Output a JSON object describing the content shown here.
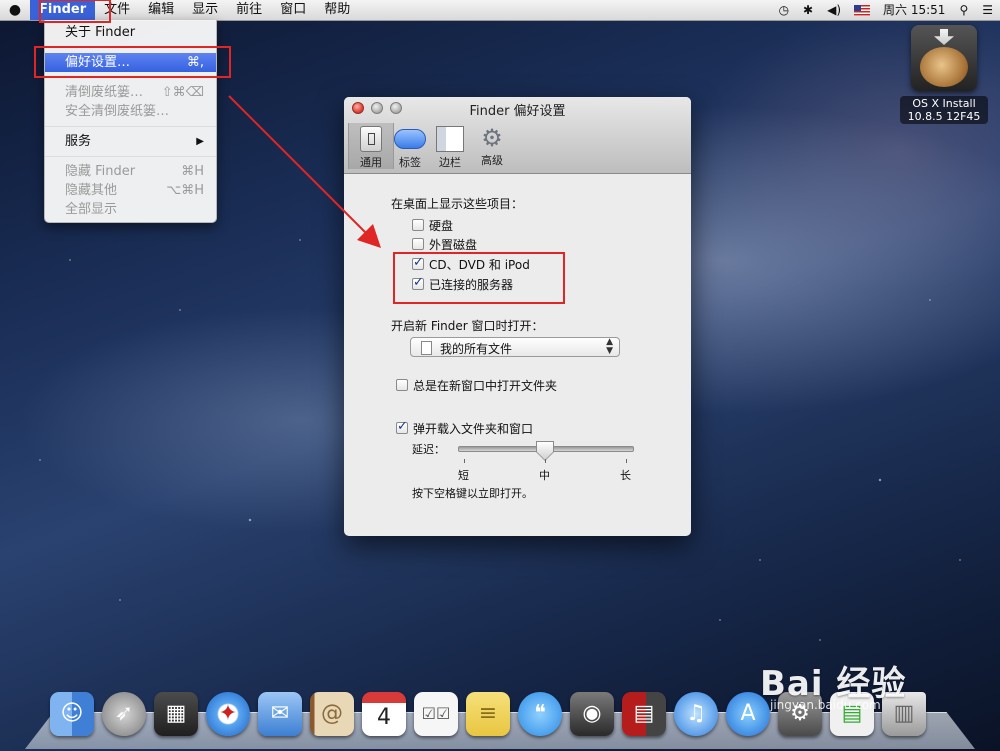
{
  "menubar": {
    "app_name": "Finder",
    "items": [
      "文件",
      "编辑",
      "显示",
      "前往",
      "窗口",
      "帮助"
    ],
    "clock": "周六 15:51"
  },
  "finder_menu": {
    "about": "关于 Finder",
    "preferences": "偏好设置…",
    "preferences_shortcut": "⌘,",
    "empty_trash": "清倒废纸篓…",
    "empty_trash_shortcut": "⇧⌘⌫",
    "secure_empty_trash": "安全清倒废纸篓…",
    "services": "服务",
    "services_arrow": "▶",
    "hide_finder": "隐藏 Finder",
    "hide_finder_shortcut": "⌘H",
    "hide_others": "隐藏其他",
    "hide_others_shortcut": "⌥⌘H",
    "show_all": "全部显示"
  },
  "desktop": {
    "disk_label_line1": "OS X Install",
    "disk_label_line2": "10.8.5 12F45"
  },
  "prefs_window": {
    "title": "Finder 偏好设置",
    "tabs": [
      "通用",
      "标签",
      "边栏",
      "高级"
    ],
    "selected_tab": "通用",
    "show_on_desktop_heading": "在桌面上显示这些项目：",
    "desktop_items": [
      {
        "label": "硬盘",
        "checked": false
      },
      {
        "label": "外置磁盘",
        "checked": false
      },
      {
        "label": "CD、DVD 和 iPod",
        "checked": true
      },
      {
        "label": "已连接的服务器",
        "checked": true
      }
    ],
    "new_window_heading": "开启新 Finder 窗口时打开：",
    "new_window_value": "我的所有文件",
    "always_open_tabs": {
      "label": "总是在新窗口中打开文件夹",
      "checked": false
    },
    "spring_loaded": {
      "label": "弹开载入文件夹和窗口",
      "checked": true
    },
    "delay_label": "延迟：",
    "delay_ticks": [
      "短",
      "中",
      "长"
    ],
    "delay_value_fraction": 0.5,
    "space_hint": "按下空格键以立即打开。"
  },
  "watermark": {
    "text": "Bai 经验",
    "sub": "jingyan.baidu.com"
  },
  "colors": {
    "menu_highlight": "#3561e0",
    "annotation_red": "#e02525"
  }
}
